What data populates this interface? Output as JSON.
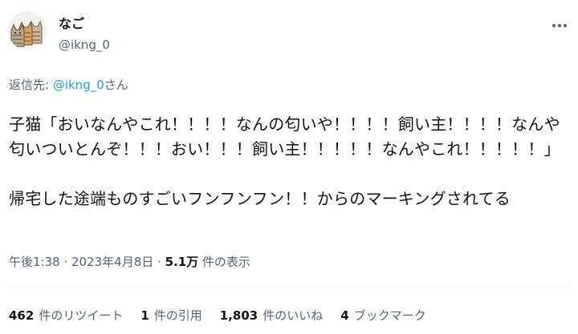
{
  "author": {
    "display_name": "なご",
    "handle": "@ikng_0"
  },
  "reply": {
    "prefix": "返信先: ",
    "target": "@ikng_0",
    "suffix": "さん"
  },
  "tweet": {
    "paragraph1": "子猫「おいなんやこれ！！！！なんの匂いや！！！！飼い主！！！！なんや匂いついとんぞ！！！おい！！！飼い主！！！！！なんやこれ！！！！！」",
    "paragraph2": "帰宅した途端ものすごいフンフンフン！！からのマーキングされてる"
  },
  "meta": {
    "time": "午後1:38",
    "separator": " · ",
    "date": "2023年4月8日",
    "views_count": "5.1万",
    "views_label": " 件の表示"
  },
  "stats": {
    "retweets": {
      "count": "462",
      "label": "件のリツイート"
    },
    "quotes": {
      "count": "1",
      "label": "件の引用"
    },
    "likes": {
      "count": "1,803",
      "label": "件のいいね"
    },
    "bookmarks": {
      "count": "4",
      "label": "ブックマーク"
    }
  },
  "colors": {
    "text": "#0f1419",
    "secondary": "#536471",
    "link": "#1d9bf0",
    "divider": "#eff3f4"
  },
  "icons": {
    "more": "more-options-icon"
  }
}
